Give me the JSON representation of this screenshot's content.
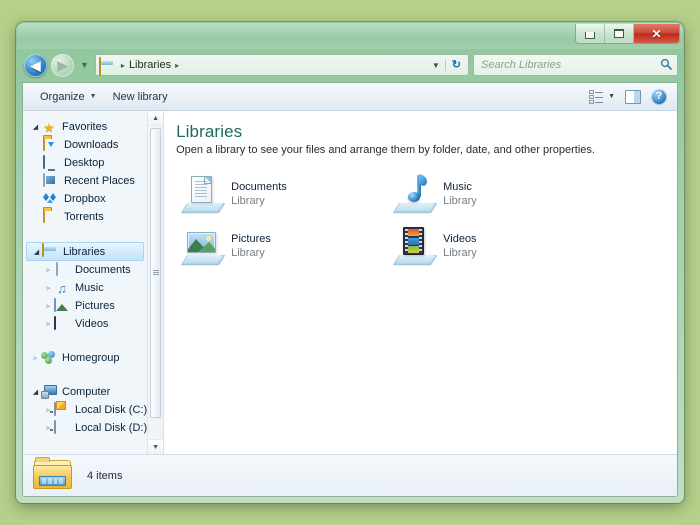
{
  "desktop": {
    "background_color": "#b6cf8a"
  },
  "window": {
    "title": "Libraries",
    "frame_color": "#a6d3ae",
    "controls": [
      {
        "name": "minimize",
        "glyph": "–"
      },
      {
        "name": "maximize",
        "glyph": "□"
      },
      {
        "name": "close",
        "glyph": "✕"
      }
    ]
  },
  "navbar": {
    "back_label": "◀",
    "forward_label": "▶",
    "recent_pages_caret": "▼",
    "breadcrumb": {
      "icon": "libraries-folder-icon",
      "separator": "▸",
      "items": [
        "Libraries"
      ],
      "trailing_separator": "▸"
    },
    "address_dropdown_caret": "▼",
    "refresh_glyph": "↻",
    "search": {
      "placeholder": "Search Libraries",
      "value": "",
      "icon_glyph": "⌕"
    }
  },
  "commandbar": {
    "organize_label": "Organize",
    "organize_caret": "▾",
    "new_library_label": "New library",
    "views_caret": "▾",
    "help_glyph": "?"
  },
  "navpane": {
    "groups": [
      {
        "header": {
          "label": "Favorites",
          "icon": "star-icon",
          "state": "expanded",
          "triangle": "◢"
        },
        "items": [
          {
            "label": "Downloads",
            "icon": "downloads-folder-icon",
            "triangle": ""
          },
          {
            "label": "Desktop",
            "icon": "desktop-monitor-icon",
            "triangle": ""
          },
          {
            "label": "Recent Places",
            "icon": "recent-places-icon",
            "triangle": ""
          },
          {
            "label": "Dropbox",
            "icon": "dropbox-icon",
            "triangle": ""
          },
          {
            "label": "Torrents",
            "icon": "folder-icon",
            "triangle": ""
          }
        ]
      },
      {
        "header": {
          "label": "Libraries",
          "icon": "libraries-folder-icon",
          "state": "expanded",
          "triangle": "◢",
          "selected": true
        },
        "items": [
          {
            "label": "Documents",
            "icon": "document-icon",
            "triangle": "▹"
          },
          {
            "label": "Music",
            "icon": "music-note-icon",
            "triangle": "▹"
          },
          {
            "label": "Pictures",
            "icon": "picture-icon",
            "triangle": "▹"
          },
          {
            "label": "Videos",
            "icon": "video-icon",
            "triangle": "▹"
          }
        ]
      },
      {
        "header": {
          "label": "Homegroup",
          "icon": "homegroup-icon",
          "state": "collapsed",
          "triangle": "▹"
        },
        "items": []
      },
      {
        "header": {
          "label": "Computer",
          "icon": "computer-icon",
          "state": "expanded",
          "triangle": "◢"
        },
        "items": [
          {
            "label": "Local Disk (C:)",
            "icon": "windows-drive-icon",
            "triangle": "▹"
          },
          {
            "label": "Local Disk (D:)",
            "icon": "drive-icon",
            "triangle": "▹"
          }
        ]
      }
    ],
    "scrollbar": {
      "up_glyph": "▲",
      "down_glyph": "▼"
    }
  },
  "content": {
    "title": "Libraries",
    "title_color": "#1d6b5c",
    "subtitle": "Open a library to see your files and arrange them by folder, date, and other properties.",
    "tiles": [
      {
        "name": "Documents",
        "sub": "Library",
        "icon": "documents-library-icon"
      },
      {
        "name": "Music",
        "sub": "Library",
        "icon": "music-library-icon"
      },
      {
        "name": "Pictures",
        "sub": "Library",
        "icon": "pictures-library-icon"
      },
      {
        "name": "Videos",
        "sub": "Library",
        "icon": "videos-library-icon"
      }
    ]
  },
  "statusbar": {
    "icon": "libraries-folder-large-icon",
    "text": "4 items"
  }
}
